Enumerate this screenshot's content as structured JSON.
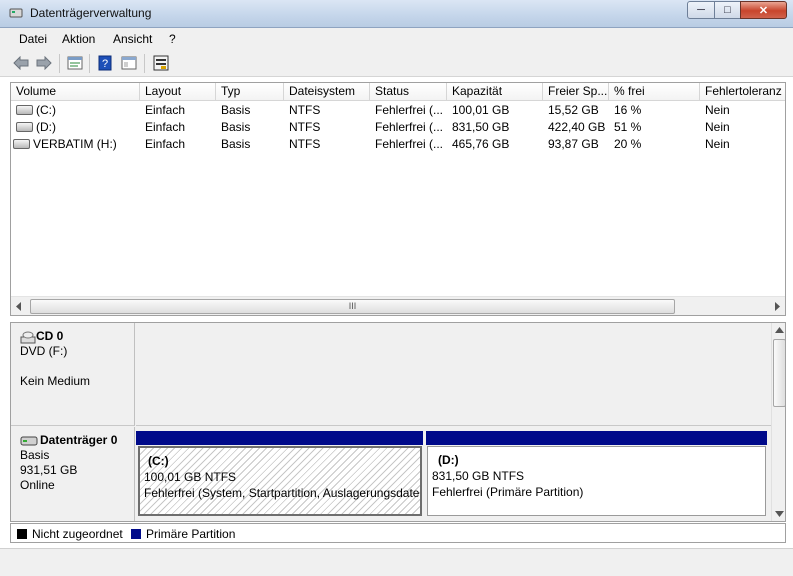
{
  "window": {
    "title": "Datenträgerverwaltung",
    "min": "─",
    "max": "□",
    "close": "✕"
  },
  "menu": [
    "Datei",
    "Aktion",
    "Ansicht",
    "?"
  ],
  "toolbar": {
    "icons": [
      "back-icon",
      "forward-icon",
      "properties-icon",
      "help-icon",
      "console-icon",
      "disk-settings-icon"
    ]
  },
  "volumes": {
    "columns": [
      "Volume",
      "Layout",
      "Typ",
      "Dateisystem",
      "Status",
      "Kapazität",
      "Freier Sp...",
      "% frei",
      "Fehlertoleranz"
    ],
    "rows": [
      [
        "(C:)",
        "Einfach",
        "Basis",
        "NTFS",
        "Fehlerfrei (...",
        "100,01 GB",
        "15,52 GB",
        "16 %",
        "Nein"
      ],
      [
        "(D:)",
        "Einfach",
        "Basis",
        "NTFS",
        "Fehlerfrei (...",
        "831,50 GB",
        "422,40 GB",
        "51 %",
        "Nein"
      ],
      [
        "VERBATIM (H:)",
        "Einfach",
        "Basis",
        "NTFS",
        "Fehlerfrei (...",
        "465,76 GB",
        "93,87 GB",
        "20 %",
        "Nein"
      ]
    ],
    "scroll_grip": "III"
  },
  "disks": {
    "cd": {
      "name": "CD 0",
      "drive": "DVD (F:)",
      "medium": "Kein Medium"
    },
    "disk0": {
      "name": "Datenträger 0",
      "type": "Basis",
      "size": "931,51 GB",
      "state": "Online",
      "partitions": [
        {
          "letter": "(C:)",
          "size": "100,01 GB NTFS",
          "status": "Fehlerfrei (System, Startpartition, Auslagerungsdatei"
        },
        {
          "letter": "(D:)",
          "size": "831,50 GB NTFS",
          "status": "Fehlerfrei (Primäre Partition)"
        }
      ]
    }
  },
  "legend": {
    "unallocated": "Nicht zugeordnet",
    "primary": "Primäre Partition",
    "colors": {
      "unallocated": "#000000",
      "primary": "#000a8a"
    }
  }
}
